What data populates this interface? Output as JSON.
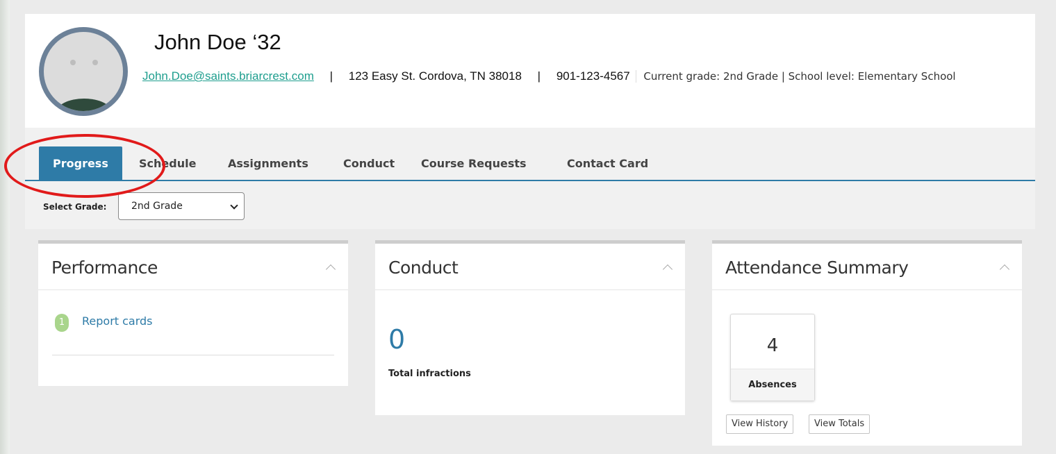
{
  "student": {
    "name": "John Doe ‘32",
    "email": "John.Doe@saints.briarcrest.com",
    "address": "123 Easy St. Cordova, TN 38018",
    "phone": "901-123-4567",
    "separator": "|",
    "grade_info": "Current grade: 2nd Grade | School level: Elementary School"
  },
  "tabs": [
    {
      "label": "Progress",
      "active": true
    },
    {
      "label": "Schedule",
      "active": false
    },
    {
      "label": "Assignments",
      "active": false
    },
    {
      "label": "Conduct",
      "active": false
    },
    {
      "label": "Course Requests",
      "active": false
    },
    {
      "label": "Contact Card",
      "active": false
    }
  ],
  "grade_select": {
    "label": "Select Grade:",
    "value": "2nd Grade"
  },
  "performance": {
    "title": "Performance",
    "report_count": "1",
    "report_label": "Report cards"
  },
  "conduct": {
    "title": "Conduct",
    "total": "0",
    "total_label": "Total infractions"
  },
  "attendance": {
    "title": "Attendance Summary",
    "absences": "4",
    "absences_label": "Absences",
    "view_history": "View History",
    "view_totals": "View Totals"
  },
  "colors": {
    "accent": "#2e7ba7",
    "link_green": "#1e9e8e",
    "badge_green": "#a9d58c",
    "highlight_red": "#e11a1a",
    "page_bg": "#ebebeb"
  },
  "icons": {
    "collapse": "chevron-up-icon",
    "select": "chevron-down-icon"
  }
}
